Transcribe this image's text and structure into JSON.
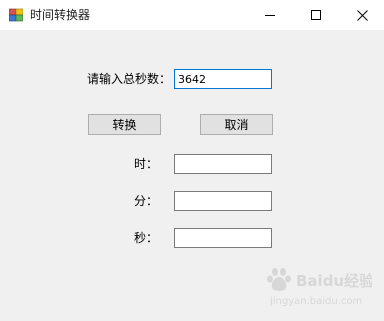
{
  "window": {
    "title": "时间转换器",
    "app_icon": "winforms-app-icon",
    "controls": {
      "minimize_icon": "minimize-icon",
      "maximize_icon": "maximize-icon",
      "close_icon": "close-icon"
    }
  },
  "form": {
    "total_seconds_label": "请输入总秒数：",
    "total_seconds_value": "3642",
    "convert_button": "转换",
    "cancel_button": "取消",
    "hours_label": "时：",
    "hours_value": "",
    "minutes_label": "分：",
    "minutes_value": "",
    "seconds_label": "秒：",
    "seconds_value": ""
  },
  "watermark": {
    "text": "Baidu经验",
    "subtext": "jingyan.baidu.com"
  },
  "colors": {
    "window_bg": "#f0f0f0",
    "titlebar_bg": "#ffffff",
    "focus_border": "#0078d7",
    "button_bg": "#e1e1e1"
  }
}
